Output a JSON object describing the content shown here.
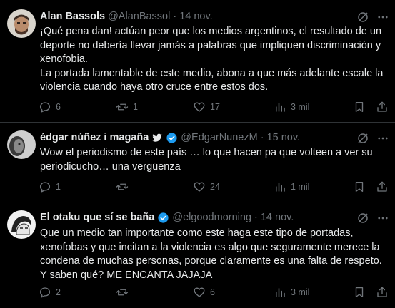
{
  "tweets": [
    {
      "name": "Alan Bassols",
      "handle": "@AlanBassol",
      "date": "14 nov.",
      "verified": false,
      "paragraphs": [
        "¡Qué pena dan! actúan peor que los medios argentinos, el resultado de un deporte no debería llevar jamás a  palabras que impliquen discriminación y xenofobia.",
        "La portada lamentable de este medio, abona a que más adelante escale la violencia cuando haya otro cruce entre estos dos."
      ],
      "replies": "6",
      "retweets": "1",
      "likes": "17",
      "views": "3 mil"
    },
    {
      "name": "édgar núñez i magaña",
      "handle": "@EdgarNunezM",
      "date": "15 nov.",
      "verified": true,
      "paragraphs": [
        "Wow el periodismo de este país … lo que hacen pa que volteen a ver su periodicucho… una vergüenza"
      ],
      "replies": "1",
      "retweets": "",
      "likes": "24",
      "views": "1 mil"
    },
    {
      "name": "El otaku que sí se baña",
      "handle": "@elgoodmorning",
      "date": "14 nov.",
      "verified": true,
      "paragraphs": [
        "Que un medio tan importante como este haga este tipo de portadas, xenofobas y que incitan a la violencia es algo que seguramente merece la condena de muchas personas, porque claramente es una falta de respeto. Y saben qué? ME ENCANTA JAJAJA"
      ],
      "replies": "2",
      "retweets": "",
      "likes": "6",
      "views": "3 mil"
    }
  ],
  "icons": {
    "reply": "reply-icon",
    "retweet": "retweet-icon",
    "like": "heart-icon",
    "views": "views-icon",
    "bookmark": "bookmark-icon",
    "share": "share-icon",
    "grok": "grok-icon",
    "more": "more-icon",
    "badge": "verified-badge-icon",
    "bird": "twitter-bird-icon"
  },
  "colors": {
    "background": "#000000",
    "text": "#e7e9ea",
    "muted": "#71767b",
    "border": "#2f3336",
    "verified": "#1d9bf0"
  }
}
